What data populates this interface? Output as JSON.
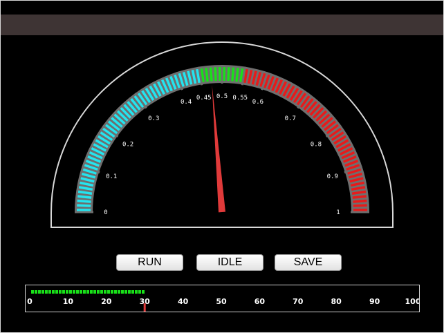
{
  "gauge": {
    "min": 0,
    "max": 1,
    "value": 0.475,
    "tick_labels": [
      "0",
      "0.1",
      "0.2",
      "0.3",
      "0.4",
      "0.45",
      "0.5",
      "0.55",
      "0.6",
      "0.7",
      "0.8",
      "0.9",
      "1"
    ],
    "zones": [
      {
        "from": 0,
        "to": 0.45,
        "color": "#23e5f0"
      },
      {
        "from": 0.45,
        "to": 0.55,
        "color": "#19e019"
      },
      {
        "from": 0.55,
        "to": 1,
        "color": "#e81a1a"
      }
    ],
    "needle_color": "#e03a3a"
  },
  "buttons": {
    "run": "RUN",
    "idle": "IDLE",
    "save": "SAVE"
  },
  "progress": {
    "min": 0,
    "max": 100,
    "value": 30,
    "tick_labels": [
      "0",
      "10",
      "20",
      "30",
      "40",
      "50",
      "60",
      "70",
      "80",
      "90",
      "100"
    ],
    "fill_color": "#19e019",
    "marker_color": "#e03a3a"
  }
}
